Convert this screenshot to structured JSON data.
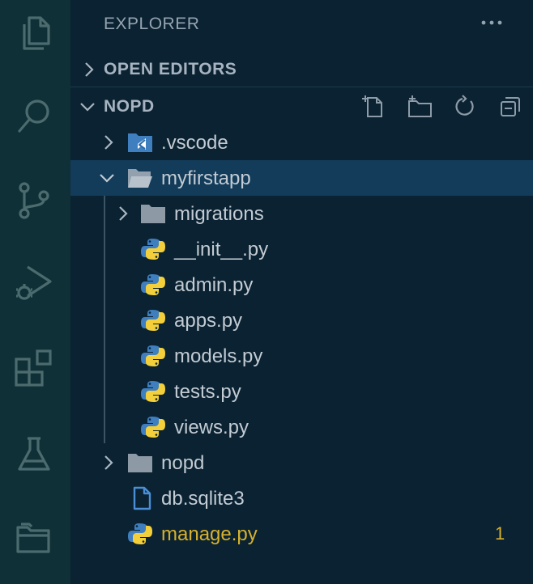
{
  "explorer": {
    "title": "EXPLORER",
    "more_actions_icon": "ellipsis-icon"
  },
  "activity_bar": {
    "items": [
      {
        "name": "explorer",
        "icon": "files-icon"
      },
      {
        "name": "search",
        "icon": "search-icon"
      },
      {
        "name": "source-control",
        "icon": "source-control-icon"
      },
      {
        "name": "run-and-debug",
        "icon": "run-debug-icon"
      },
      {
        "name": "extensions",
        "icon": "extensions-icon"
      },
      {
        "name": "testing",
        "icon": "flask-icon"
      },
      {
        "name": "remote-explorer",
        "icon": "folder-stack-icon"
      }
    ]
  },
  "sections": {
    "open_editors": "OPEN EDITORS",
    "workspace": "NOPD"
  },
  "workspace_actions": [
    "new-file-icon",
    "new-folder-icon",
    "refresh-icon",
    "collapse-all-icon"
  ],
  "tree": [
    {
      "label": ".vscode",
      "type": "folder",
      "expanded": false
    },
    {
      "label": "myfirstapp",
      "type": "folder",
      "expanded": true,
      "selected": true
    },
    {
      "label": "migrations",
      "type": "folder",
      "expanded": false
    },
    {
      "label": "__init__.py",
      "type": "python"
    },
    {
      "label": "admin.py",
      "type": "python"
    },
    {
      "label": "apps.py",
      "type": "python"
    },
    {
      "label": "models.py",
      "type": "python"
    },
    {
      "label": "tests.py",
      "type": "python"
    },
    {
      "label": "views.py",
      "type": "python"
    },
    {
      "label": "nopd",
      "type": "folder",
      "expanded": false
    },
    {
      "label": "db.sqlite3",
      "type": "file"
    },
    {
      "label": "manage.py",
      "type": "python",
      "modified": true,
      "badge": "1"
    }
  ],
  "colors": {
    "activity_bar_bg": "#0f3036",
    "sidebar_bg": "#0a2231",
    "selection_bg": "#133c5a",
    "modified_text": "#d7b12e",
    "python_blue": "#3f7fbf",
    "python_yellow": "#f2cf3b"
  }
}
